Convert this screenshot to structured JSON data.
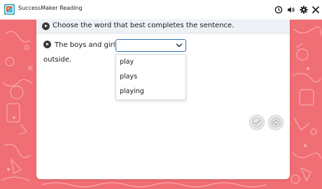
{
  "app": {
    "title": "SuccessMaker Reading"
  },
  "toolbar": {
    "icons": [
      "timer-icon",
      "speaker-icon",
      "gear-icon",
      "close-icon"
    ]
  },
  "question": {
    "prompt": "Choose the word that best completes the sentence.",
    "sentence_start": "The boys and girls",
    "sentence_end": "outside.",
    "selected_value": "",
    "options": [
      "play",
      "plays",
      "playing"
    ]
  },
  "navigation": {
    "icons": [
      "check-icon",
      "next-arrow-icon"
    ]
  },
  "colors": {
    "background_pink": "#f06f74",
    "select_border": "#2e6fb4"
  }
}
